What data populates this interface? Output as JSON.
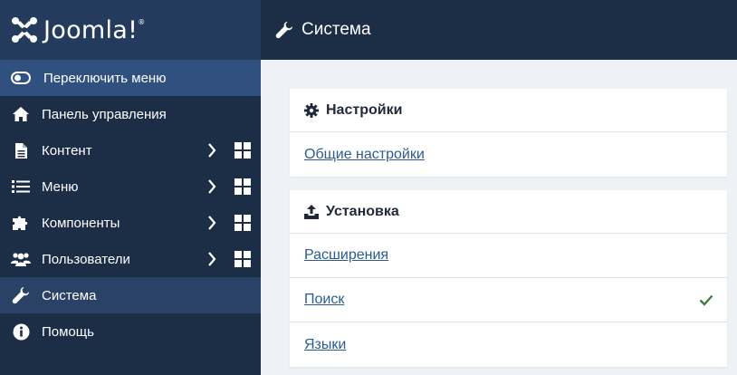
{
  "brand": {
    "name": "Joomla!",
    "trademark": "®"
  },
  "sidebar": {
    "toggle_label": "Переключить меню",
    "items": [
      {
        "label": "Панель управления",
        "icon": "home-icon"
      },
      {
        "label": "Контент",
        "icon": "file-icon",
        "has_submenu": true
      },
      {
        "label": "Меню",
        "icon": "list-icon",
        "has_submenu": true
      },
      {
        "label": "Компоненты",
        "icon": "puzzle-icon",
        "has_submenu": true
      },
      {
        "label": "Пользователи",
        "icon": "users-icon",
        "has_submenu": true
      },
      {
        "label": "Система",
        "icon": "wrench-icon",
        "active": true
      },
      {
        "label": "Помощь",
        "icon": "info-icon"
      }
    ]
  },
  "header": {
    "title": "Система",
    "icon": "wrench-icon"
  },
  "cards": {
    "settings": {
      "title": "Настройки",
      "icon": "gear-icon",
      "links": [
        "Общие настройки"
      ]
    },
    "install": {
      "title": "Установка",
      "icon": "upload-icon",
      "links": [
        "Расширения",
        "Поиск",
        "Языки"
      ],
      "checked_link": "Поиск"
    }
  },
  "colors": {
    "sidebar_bg": "#1c2d46",
    "brand_bg": "#243b5e",
    "toggle_bg": "#30517f",
    "active_bg": "#2a4266",
    "link": "#2a5c92",
    "check": "#3f7d41",
    "content_bg": "#eef1f5"
  }
}
